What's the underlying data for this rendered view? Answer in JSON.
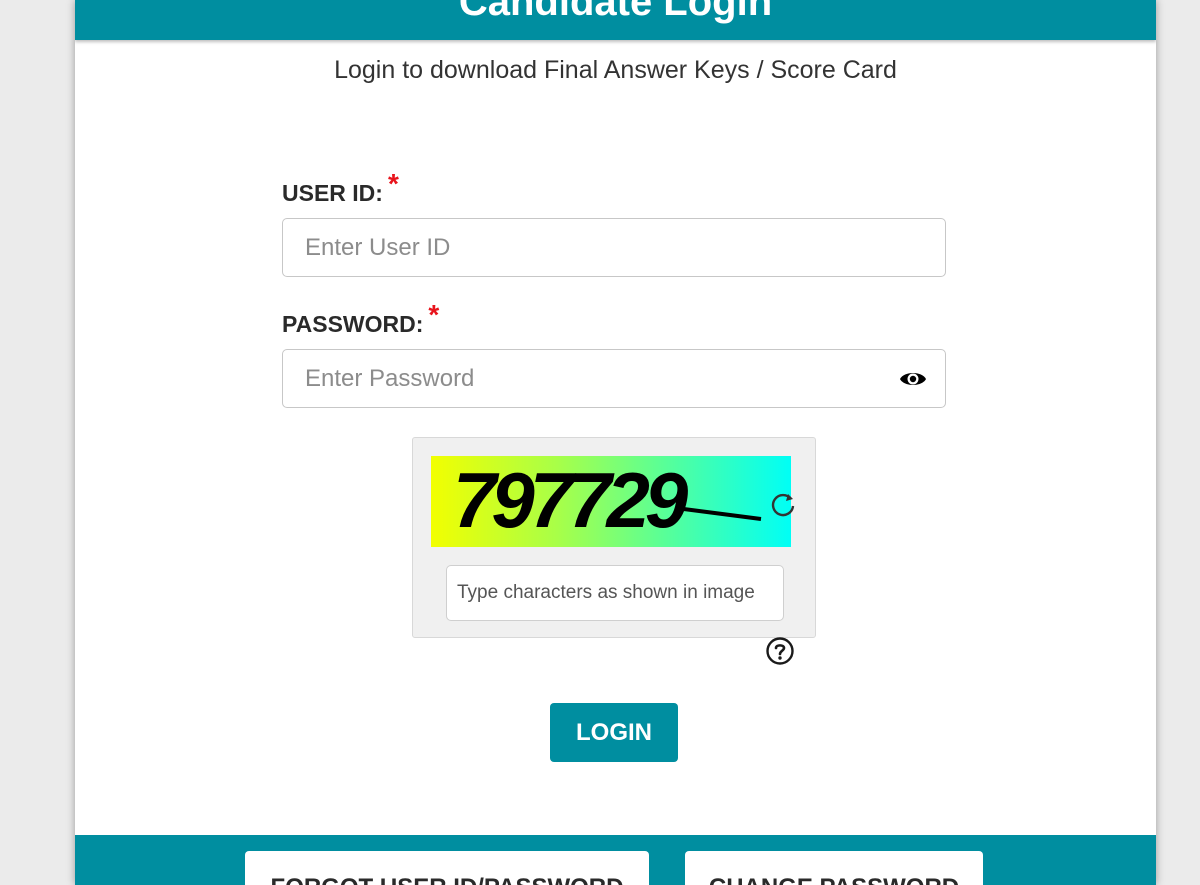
{
  "header": {
    "title": "Candidate Login"
  },
  "subtitle": "Login to download Final Answer Keys / Score Card",
  "form": {
    "user_id": {
      "label": "USER ID:",
      "required_mark": "*",
      "placeholder": "Enter User ID",
      "value": ""
    },
    "password": {
      "label": "PASSWORD:",
      "required_mark": "*",
      "placeholder": "Enter Password",
      "value": "",
      "toggle_icon": "eye-icon"
    },
    "captcha": {
      "code": "797729",
      "placeholder": "Type characters as shown in image",
      "value": "",
      "refresh_icon": "refresh-icon",
      "help_icon": "question-circle-icon",
      "gradient_colors": [
        "#f2ff00",
        "#00fff6"
      ]
    },
    "login_label": "LOGIN"
  },
  "footer": {
    "forgot_label": "FORGOT USER ID/PASSWORD",
    "change_password_label": "CHANGE PASSWORD"
  },
  "colors": {
    "accent": "#008ea0",
    "required": "#e8141c",
    "page_background": "#ebebeb"
  }
}
